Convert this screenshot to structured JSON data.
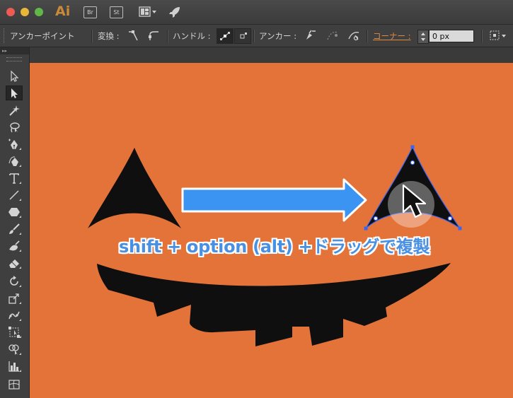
{
  "app": {
    "logo": "Ai",
    "bridge_label": "Br",
    "stock_label": "St"
  },
  "control_bar": {
    "mode_label": "アンカーポイント",
    "convert_label": "変換 :",
    "handle_label": "ハンドル :",
    "anchor_label": "アンカー :",
    "corner_label": "コーナー :",
    "corner_value": "0 px"
  },
  "canvas": {
    "caption": "shift + option (alt) +ドラッグで複製",
    "background_color": "#e4733a",
    "face_color": "#0f0f0f",
    "selection_color": "#3a64f2",
    "arrow_color": "#3b93f2"
  },
  "tools": [
    {
      "name": "selection-tool"
    },
    {
      "name": "direct-selection-tool",
      "selected": true
    },
    {
      "name": "magic-wand-tool"
    },
    {
      "name": "lasso-tool"
    },
    {
      "name": "pen-tool"
    },
    {
      "name": "curvature-tool"
    },
    {
      "name": "type-tool"
    },
    {
      "name": "line-segment-tool"
    },
    {
      "name": "polygon-tool"
    },
    {
      "name": "paintbrush-tool"
    },
    {
      "name": "blob-brush-tool"
    },
    {
      "name": "eraser-tool"
    },
    {
      "name": "rotate-tool"
    },
    {
      "name": "scale-tool"
    },
    {
      "name": "puppet-warp-tool"
    },
    {
      "name": "free-transform-tool"
    },
    {
      "name": "shape-builder-tool"
    },
    {
      "name": "column-graph-tool"
    },
    {
      "name": "mesh-tool"
    }
  ]
}
